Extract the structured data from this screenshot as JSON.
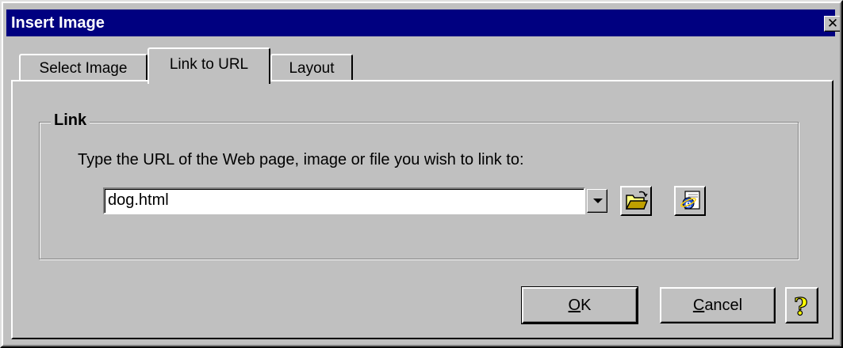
{
  "window": {
    "title": "Insert Image",
    "close_glyph": "✕"
  },
  "tabs": [
    {
      "label": "Select Image",
      "active": false
    },
    {
      "label": "Link to URL",
      "active": true
    },
    {
      "label": "Layout",
      "active": false
    }
  ],
  "link_group": {
    "title": "Link",
    "prompt": "Type the URL of the Web page, image or file you wish to link to:",
    "url_value": "dog.html"
  },
  "buttons": {
    "ok": {
      "mnemonic": "O",
      "rest": "K"
    },
    "cancel": {
      "mnemonic": "C",
      "rest": "ancel"
    },
    "help_glyph": "?"
  },
  "icons": {
    "dropdown": "chevron-down-icon",
    "browse": "open-folder-icon",
    "web": "internet-explorer-icon",
    "help": "help-icon"
  },
  "colors": {
    "title_bar": "#000080",
    "face": "#c0c0c0",
    "help_yellow": "#ffff00"
  }
}
